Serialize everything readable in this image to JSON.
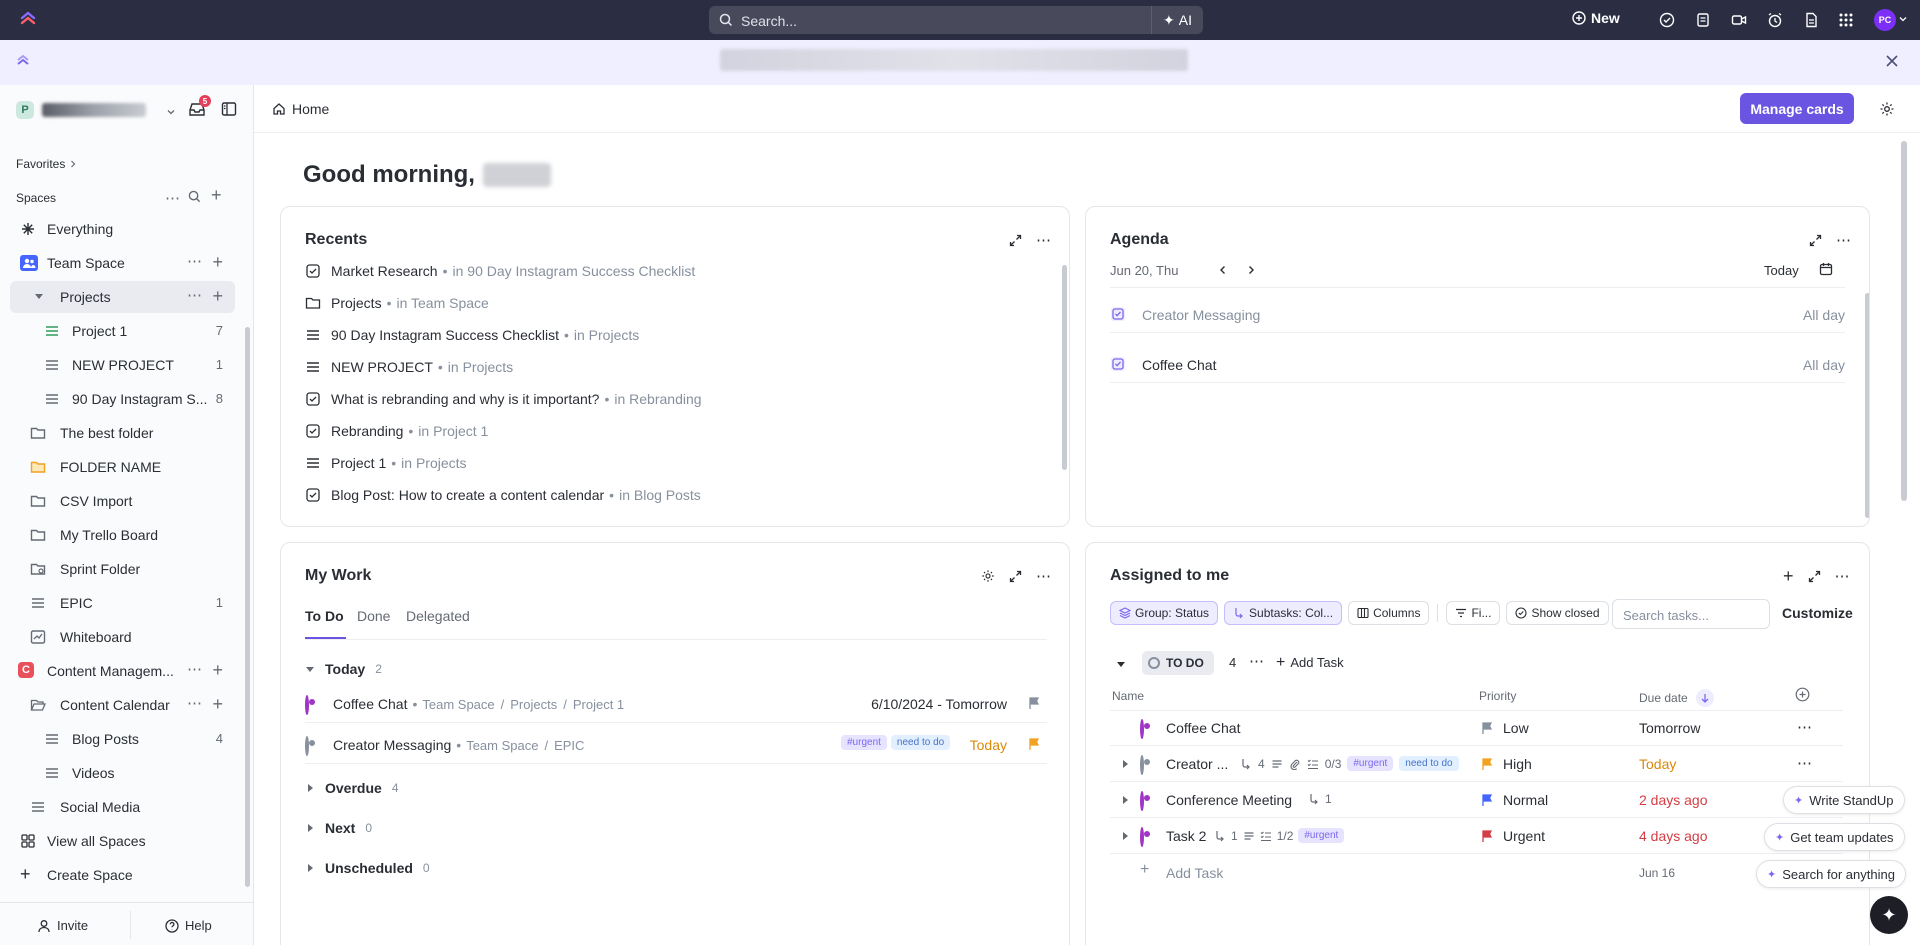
{
  "topbar": {
    "search_placeholder": "Search...",
    "ai_label": "AI",
    "new_label": "New",
    "avatar_initials": "PC"
  },
  "sidebar": {
    "workspace_initial": "P",
    "inbox_badge": "5",
    "favorites_label": "Favorites",
    "spaces_label": "Spaces",
    "items": [
      {
        "label": "Everything",
        "count": ""
      },
      {
        "label": "Team Space",
        "count": ""
      },
      {
        "label": "Projects",
        "count": ""
      },
      {
        "label": "Project 1",
        "count": "7"
      },
      {
        "label": "NEW PROJECT",
        "count": "1"
      },
      {
        "label": "90 Day Instagram S...",
        "count": "8"
      },
      {
        "label": "The best folder",
        "count": ""
      },
      {
        "label": "FOLDER NAME",
        "count": ""
      },
      {
        "label": "CSV Import",
        "count": ""
      },
      {
        "label": "My Trello Board",
        "count": ""
      },
      {
        "label": "Sprint Folder",
        "count": ""
      },
      {
        "label": "EPIC",
        "count": "1"
      },
      {
        "label": "Whiteboard",
        "count": ""
      },
      {
        "label": "Content Managem...",
        "count": ""
      },
      {
        "label": "Content Calendar",
        "count": ""
      },
      {
        "label": "Blog Posts",
        "count": "4"
      },
      {
        "label": "Videos",
        "count": ""
      },
      {
        "label": "Social Media",
        "count": ""
      },
      {
        "label": "View all Spaces",
        "count": ""
      },
      {
        "label": "Create Space",
        "count": ""
      }
    ],
    "content_space_initial": "C",
    "invite_label": "Invite",
    "help_label": "Help"
  },
  "main": {
    "breadcrumb": "Home",
    "manage_cards_label": "Manage cards",
    "greeting": "Good morning,",
    "recents": {
      "title": "Recents",
      "items": [
        {
          "name": "Market Research",
          "location": "in 90 Day Instagram Success Checklist"
        },
        {
          "name": "Projects",
          "location": "in Team Space"
        },
        {
          "name": "90 Day Instagram Success Checklist",
          "location": "in Projects"
        },
        {
          "name": "NEW PROJECT",
          "location": "in Projects"
        },
        {
          "name": "What is rebranding and why is it important?",
          "location": "in Rebranding"
        },
        {
          "name": "Rebranding",
          "location": "in Project 1"
        },
        {
          "name": "Project 1",
          "location": "in Projects"
        },
        {
          "name": "Blog Post: How to create a content calendar",
          "location": "in Blog Posts"
        }
      ]
    },
    "agenda": {
      "title": "Agenda",
      "date": "Jun 20, Thu",
      "today_label": "Today",
      "events": [
        {
          "name": "Creator Messaging",
          "time": "All day"
        },
        {
          "name": "Coffee Chat",
          "time": "All day"
        }
      ]
    },
    "mywork": {
      "title": "My Work",
      "tabs": [
        "To Do",
        "Done",
        "Delegated"
      ],
      "today_label": "Today",
      "today_count": "2",
      "tasks": [
        {
          "name": "Coffee Chat",
          "path": [
            "Team Space",
            "Projects",
            "Project 1"
          ],
          "due": "6/10/2024 - Tomorrow"
        },
        {
          "name": "Creator Messaging",
          "path": [
            "Team Space",
            "EPIC"
          ],
          "tags": [
            "#urgent",
            "need to do"
          ],
          "due": "Today"
        }
      ],
      "groups": [
        {
          "label": "Overdue",
          "count": "4"
        },
        {
          "label": "Next",
          "count": "0"
        },
        {
          "label": "Unscheduled",
          "count": "0"
        }
      ]
    },
    "assigned": {
      "title": "Assigned to me",
      "chips": [
        "Group: Status",
        "Subtasks: Col...",
        "Columns",
        "Fi...",
        "Show closed"
      ],
      "search_placeholder": "Search tasks...",
      "customize_label": "Customize",
      "status_label": "TO DO",
      "status_count": "4",
      "add_task_label": "Add Task",
      "columns": [
        "Name",
        "Priority",
        "Due date"
      ],
      "rows": [
        {
          "name": "Coffee Chat",
          "subtasks": "",
          "checklist": "",
          "tags": [],
          "priority": "Low",
          "due": "Tomorrow"
        },
        {
          "name": "Creator ...",
          "subtasks": "4",
          "checklist": "0/3",
          "tags": [
            "#urgent",
            "need to do"
          ],
          "priority": "High",
          "due": "Today"
        },
        {
          "name": "Conference Meeting",
          "subtasks": "1",
          "checklist": "",
          "tags": [],
          "priority": "Normal",
          "due": "2 days ago"
        },
        {
          "name": "Task 2",
          "subtasks": "1",
          "checklist": "1/2",
          "tags": [
            "#urgent"
          ],
          "priority": "Urgent",
          "due": "4 days ago"
        }
      ],
      "add_task_row_label": "Add Task",
      "add_task_row_due": "Jun 16"
    },
    "floating": [
      "Write StandUp",
      "Get team updates",
      "Search for anything"
    ]
  },
  "colors": {
    "accent": "#7b68ee",
    "topbar": "#2b2d42",
    "status_purple": "#9f34c6",
    "priority_low": "#87909e",
    "priority_high": "#f0a220",
    "priority_normal": "#4466ff",
    "priority_urgent": "#d33d44",
    "due_today": "#d9890c",
    "overdue": "#d33d44"
  }
}
